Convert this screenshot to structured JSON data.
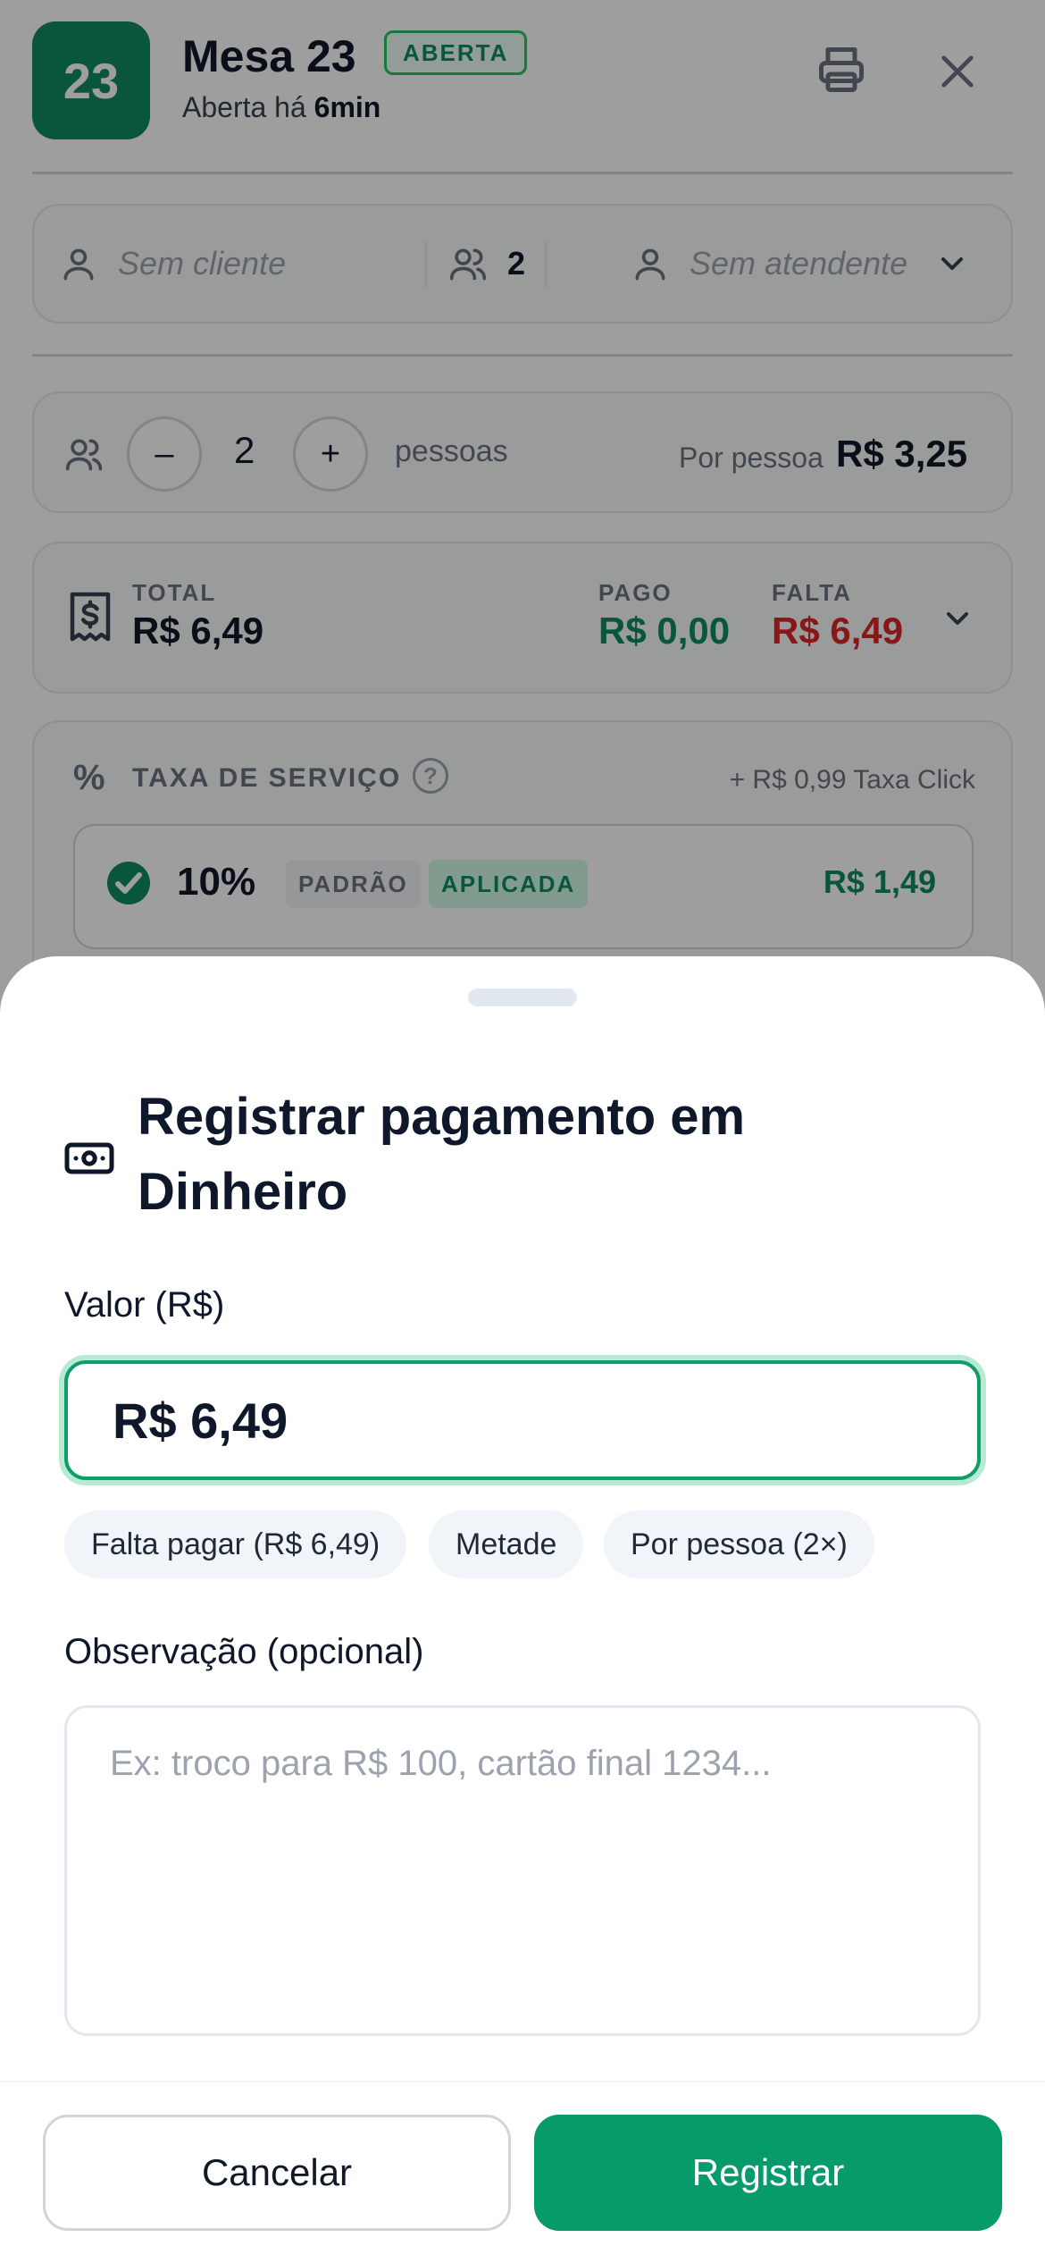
{
  "header": {
    "table_number": "23",
    "title": "Mesa 23",
    "status": "ABERTA",
    "opened_prefix": "Aberta há",
    "opened_time": "6min",
    "icons": [
      "printer-icon",
      "close-icon"
    ]
  },
  "client_row": {
    "client_placeholder": "Sem cliente",
    "guests": "2",
    "attendant_placeholder": "Sem atendente"
  },
  "people_row": {
    "minus": "–",
    "count": "2",
    "plus": "+",
    "unit": "pessoas",
    "per_person_label": "Por pessoa",
    "per_person_value": "R$ 3,25"
  },
  "totals": {
    "total_label": "TOTAL",
    "total_value": "R$ 6,49",
    "paid_label": "PAGO",
    "paid_value": "R$ 0,00",
    "missing_label": "FALTA",
    "missing_value": "R$ 6,49"
  },
  "service_tax": {
    "symbol": "%",
    "label": "TAXA DE SERVIÇO",
    "help": "?",
    "extra": "+ R$ 0,99 Taxa Click",
    "option": {
      "percent": "10%",
      "default_badge": "PADRÃO",
      "applied_badge": "APLICADA",
      "value": "R$ 1,49"
    }
  },
  "sheet": {
    "title": "Registrar pagamento em Dinheiro",
    "amount_label": "Valor (R$)",
    "amount_value": "R$ 6,49",
    "quick_amounts": [
      "Falta pagar (R$ 6,49)",
      "Metade",
      "Por pessoa (2×)"
    ],
    "note_label": "Observação (opcional)",
    "note_placeholder": "Ex: troco para R$ 100, cartão final 1234...",
    "cancel": "Cancelar",
    "submit": "Registrar"
  },
  "colors": {
    "brand_green": "#0f8b5f",
    "button_green": "#079a6b",
    "missing_red": "#dc2626",
    "overlay": "rgba(0,0,0,0.38)"
  }
}
